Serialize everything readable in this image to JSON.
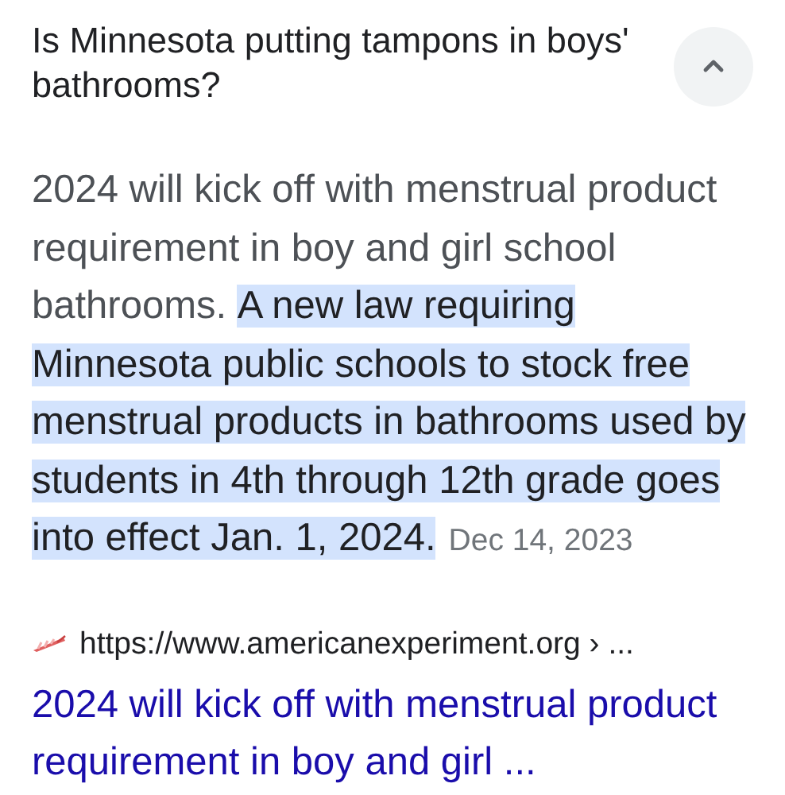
{
  "question": {
    "text": "Is Minnesota putting tampons in boys' bathrooms?",
    "expanded": true
  },
  "answer": {
    "text": "2024 will kick off with menstrual product requirement in boy and girl school bathrooms.",
    "highlight": "A new law requiring Minnesota public schools to stock free menstrual products in bathrooms used by students in 4th through 12th grade goes into effect Jan. 1, 2024.",
    "date": "Dec 14, 2023"
  },
  "source": {
    "url": "https://www.americanexperiment.org › ...",
    "title": "2024 will kick off with menstrual product requirement in boy and girl ..."
  }
}
